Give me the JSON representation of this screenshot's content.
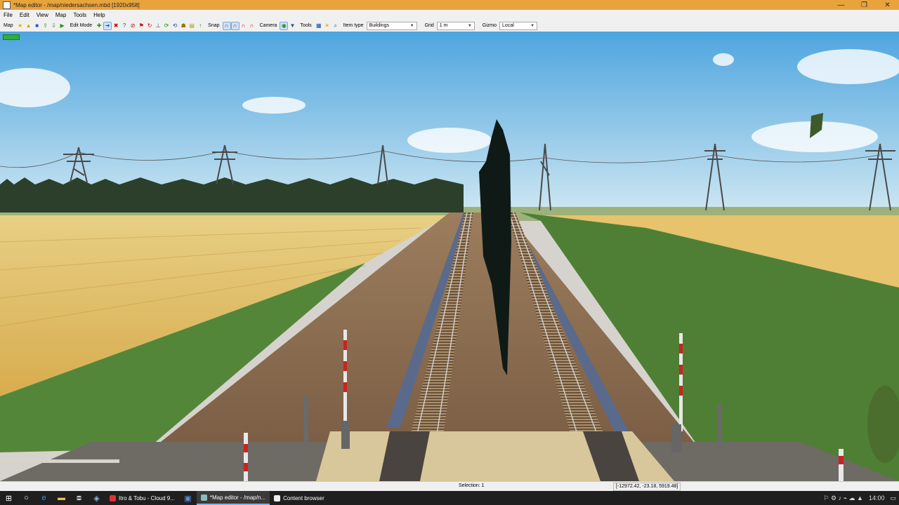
{
  "window": {
    "title": "*Map editor - /map/niedersachsen.mbd [1920x958]",
    "minimize": "—",
    "maximize": "❐",
    "close": "✕"
  },
  "menu": [
    "File",
    "Edit",
    "View",
    "Map",
    "Tools",
    "Help"
  ],
  "toolbar": {
    "map_label": "Map",
    "edit_mode_label": "Edit Mode",
    "snap_label": "Snap",
    "camera_label": "Camera",
    "tools_label": "Tools",
    "item_type_label": "Item type",
    "item_type_value": "Buildings",
    "grid_label": "Grid",
    "grid_value": "1 m",
    "gizmo_label": "Gizmo",
    "gizmo_value": "Local"
  },
  "status": {
    "selection": "Selection: 1",
    "coords": "[-12972.42, -23.18, 5919.48]"
  },
  "taskbar": {
    "items": [
      {
        "label": "Itro & Tobu - Cloud 9...",
        "color": "#d33"
      },
      {
        "label": "*Map editor - /map/n...",
        "color": "#8bb"
      },
      {
        "label": "Content browser",
        "color": "#eee"
      }
    ],
    "time": "14:00"
  },
  "colors": {
    "titlebar": "#e8a33d",
    "sky": "#6cb7e6",
    "field": "#e3c26a",
    "grass": "#55893a",
    "gravel": "#8c6e52"
  }
}
